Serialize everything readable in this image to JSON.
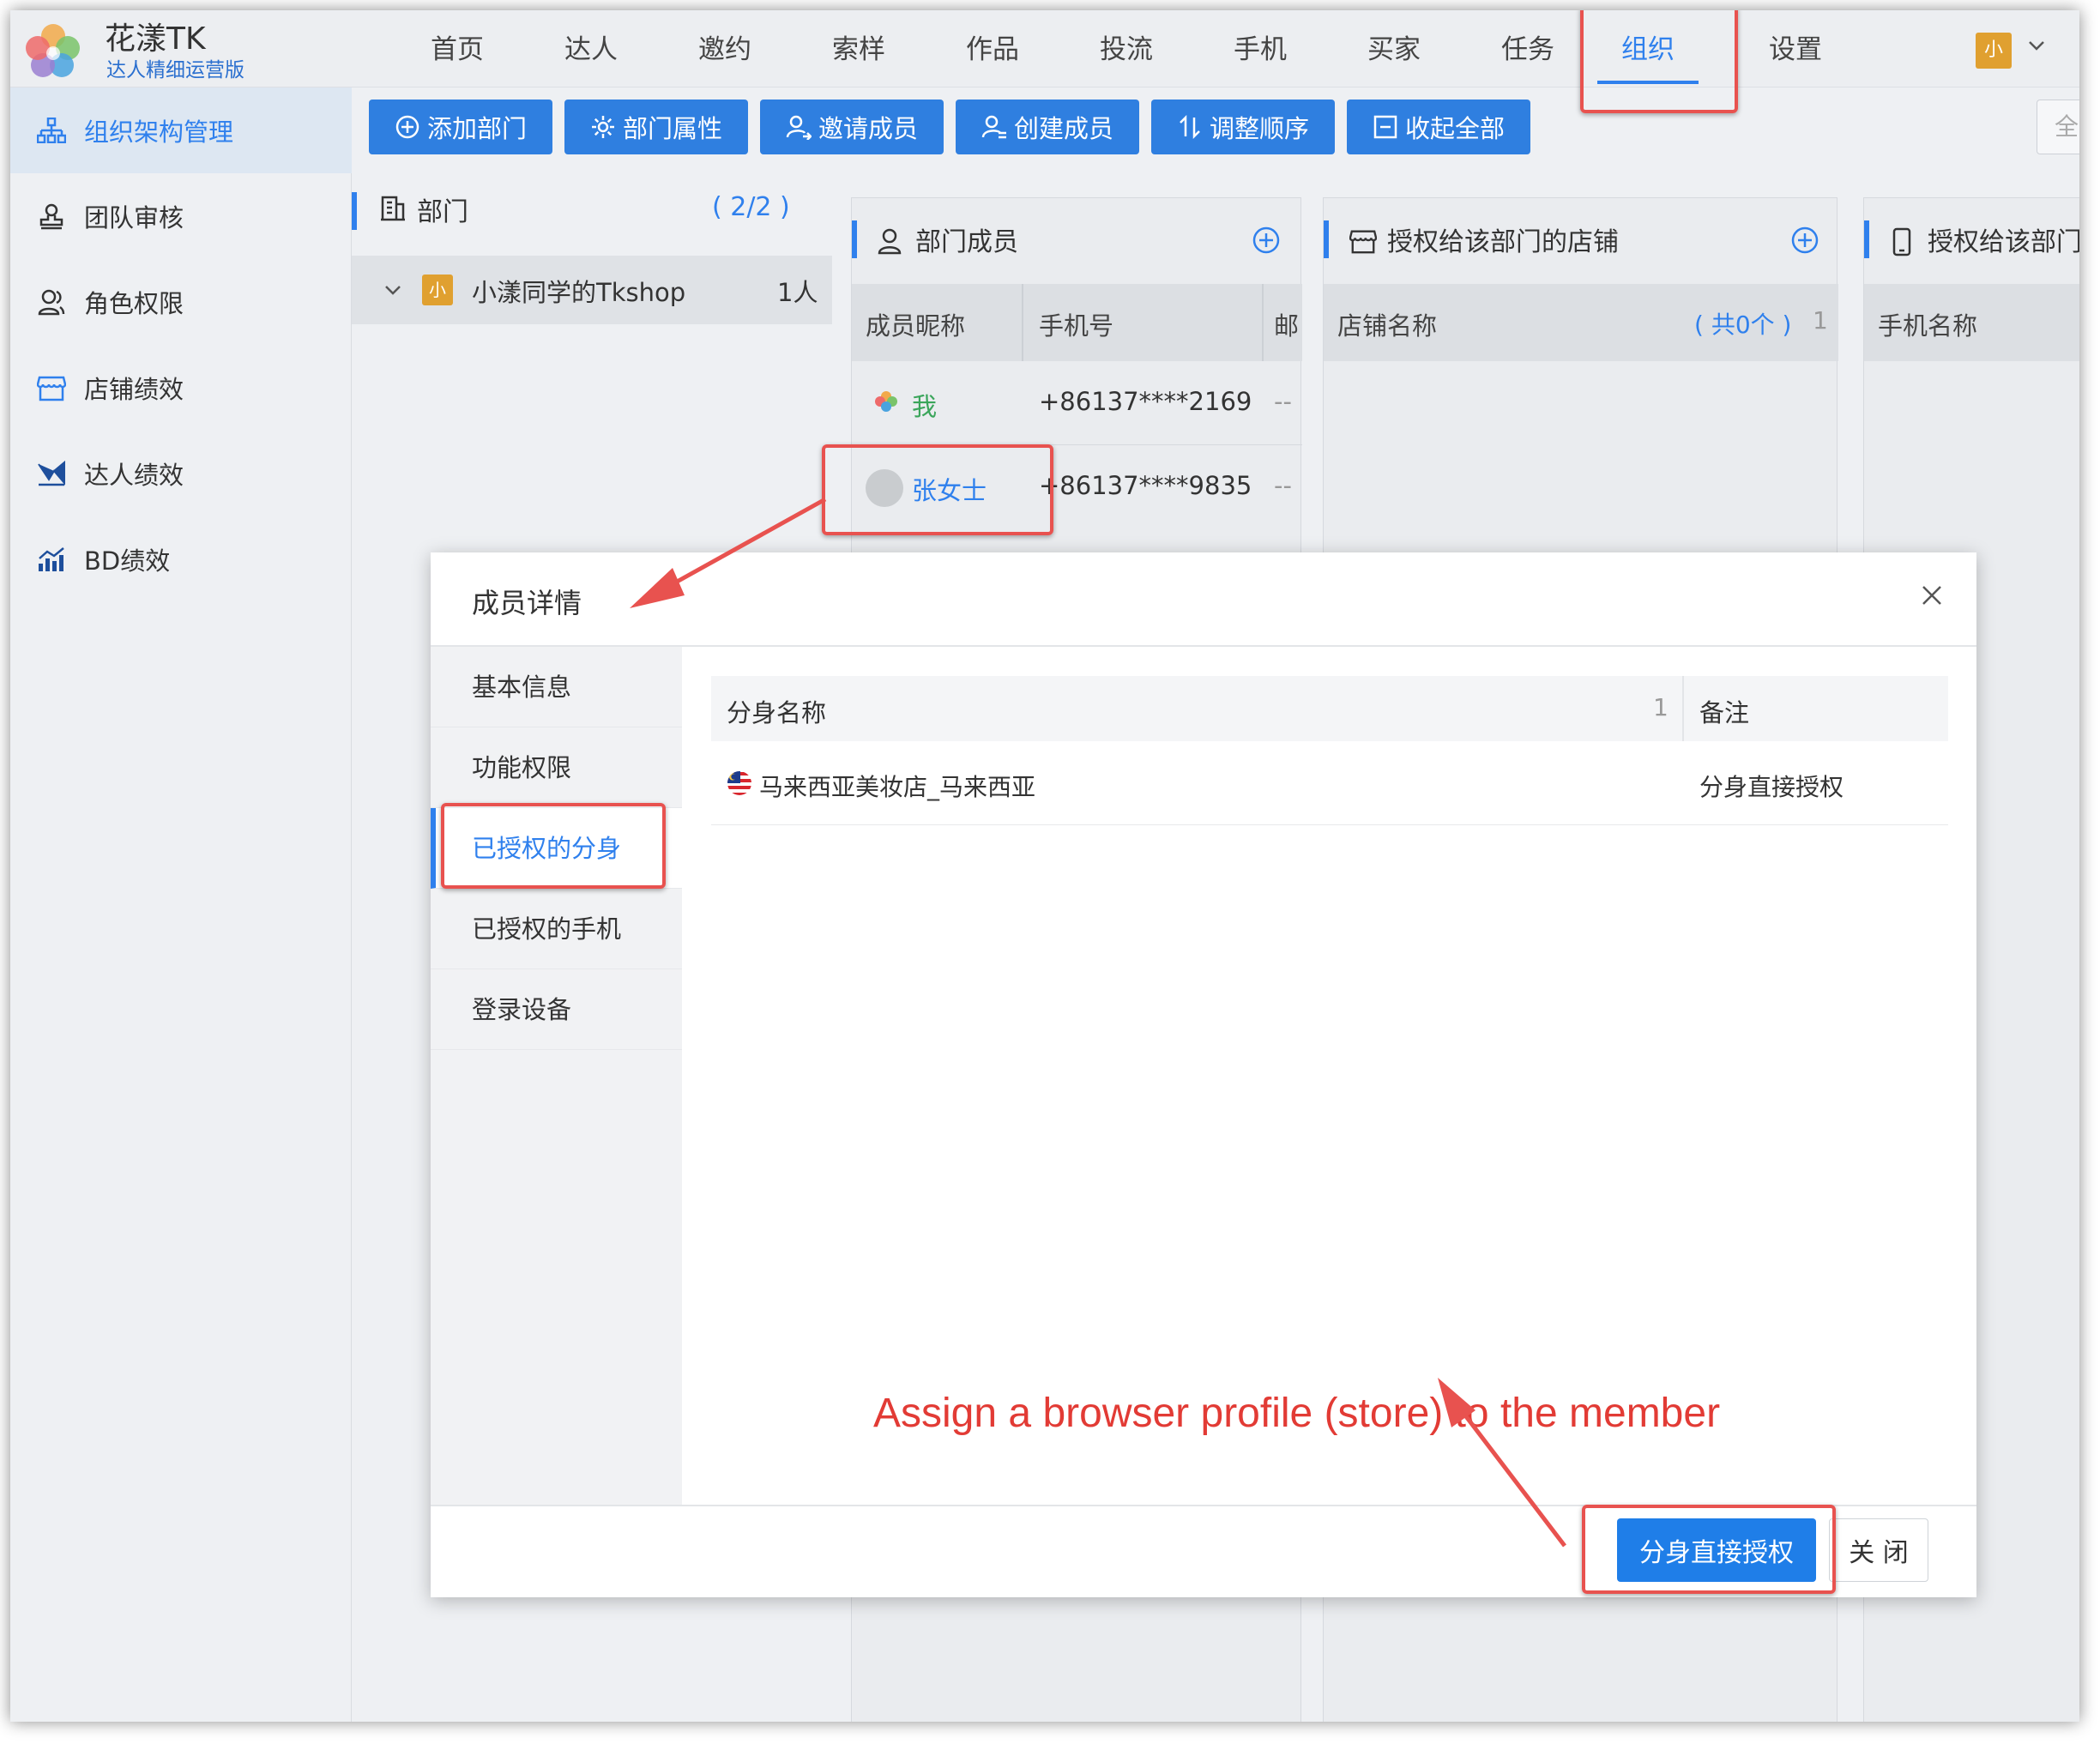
{
  "app": {
    "name": "花漾TK",
    "subtitle": "达人精细运营版"
  },
  "nav": {
    "items": [
      "首页",
      "达人",
      "邀约",
      "索样",
      "作品",
      "投流",
      "手机",
      "买家",
      "任务",
      "组织",
      "设置"
    ],
    "active": "组织",
    "user_initial": "小"
  },
  "sidebar": {
    "items": [
      {
        "label": "组织架构管理",
        "icon": "org-chart-icon"
      },
      {
        "label": "团队审核",
        "icon": "stamp-icon"
      },
      {
        "label": "角色权限",
        "icon": "users-icon"
      },
      {
        "label": "店铺绩效",
        "icon": "shop-icon"
      },
      {
        "label": "达人绩效",
        "icon": "trend-icon"
      },
      {
        "label": "BD绩效",
        "icon": "bar-chart-icon"
      }
    ],
    "active": "组织架构管理"
  },
  "toolbar": {
    "add_dept": "添加部门",
    "dept_props": "部门属性",
    "invite_member": "邀请成员",
    "create_member": "创建成员",
    "adjust_order": "调整顺序",
    "collapse_all": "收起全部",
    "edge_label": "全"
  },
  "dept_panel": {
    "title": "部门",
    "count": "( 2/2 )",
    "row": {
      "initial": "小",
      "name": "小漾同学的Tkshop",
      "count": "1人"
    }
  },
  "members_card": {
    "title": "部门成员",
    "columns": [
      "成员昵称",
      "手机号",
      "邮"
    ],
    "rows": [
      {
        "name": "我",
        "phone": "+86137****2169",
        "extra": "--"
      },
      {
        "name": "张女士",
        "phone": "+86137****9835",
        "extra": "--"
      }
    ]
  },
  "shops_card": {
    "title": "授权给该部门的店铺",
    "column": "店铺名称",
    "count": "( 共0个 )",
    "sort": "1"
  },
  "phones_card": {
    "title": "授权给该部门",
    "column": "手机名称"
  },
  "modal": {
    "title": "成员详情",
    "tabs": [
      "基本信息",
      "功能权限",
      "已授权的分身",
      "已授权的手机",
      "登录设备"
    ],
    "active_tab": "已授权的分身",
    "table": {
      "col_name": "分身名称",
      "col_sort": "1",
      "col_note": "备注",
      "rows": [
        {
          "flag": "malaysia-flag-icon",
          "name": "马来西亚美妆店_马来西亚",
          "note": "分身直接授权"
        }
      ]
    },
    "primary_button": "分身直接授权",
    "close_button": "关 闭"
  },
  "annotation": {
    "text": "Assign a browser profile (store) to the member",
    "color": "#e23b35"
  },
  "colors": {
    "accent": "#2f80ed",
    "highlight_red": "#e8524f",
    "success_green": "#3aa55a"
  }
}
